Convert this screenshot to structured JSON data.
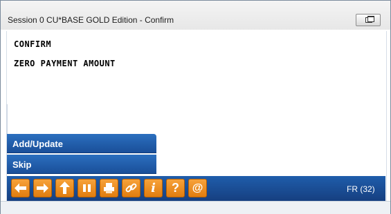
{
  "window": {
    "title": "Session 0 CU*BASE GOLD Edition - Confirm"
  },
  "screen": {
    "heading": "CONFIRM",
    "message": "ZERO PAYMENT AMOUNT"
  },
  "menu": {
    "items": [
      {
        "label": "Add/Update"
      },
      {
        "label": "Skip"
      }
    ]
  },
  "toolbar": {
    "buttons": [
      {
        "icon": "back-arrow-icon"
      },
      {
        "icon": "forward-arrow-icon"
      },
      {
        "icon": "up-arrow-icon"
      },
      {
        "icon": "pause-icon"
      },
      {
        "icon": "print-icon"
      },
      {
        "icon": "link-icon"
      },
      {
        "icon": "info-icon"
      },
      {
        "icon": "help-icon"
      },
      {
        "icon": "email-icon"
      }
    ],
    "status_code": "FR (32)"
  },
  "colors": {
    "toolbar_bg": "#1a4f99",
    "button_orange": "#f0901f",
    "menu_blue": "#2563b0"
  }
}
